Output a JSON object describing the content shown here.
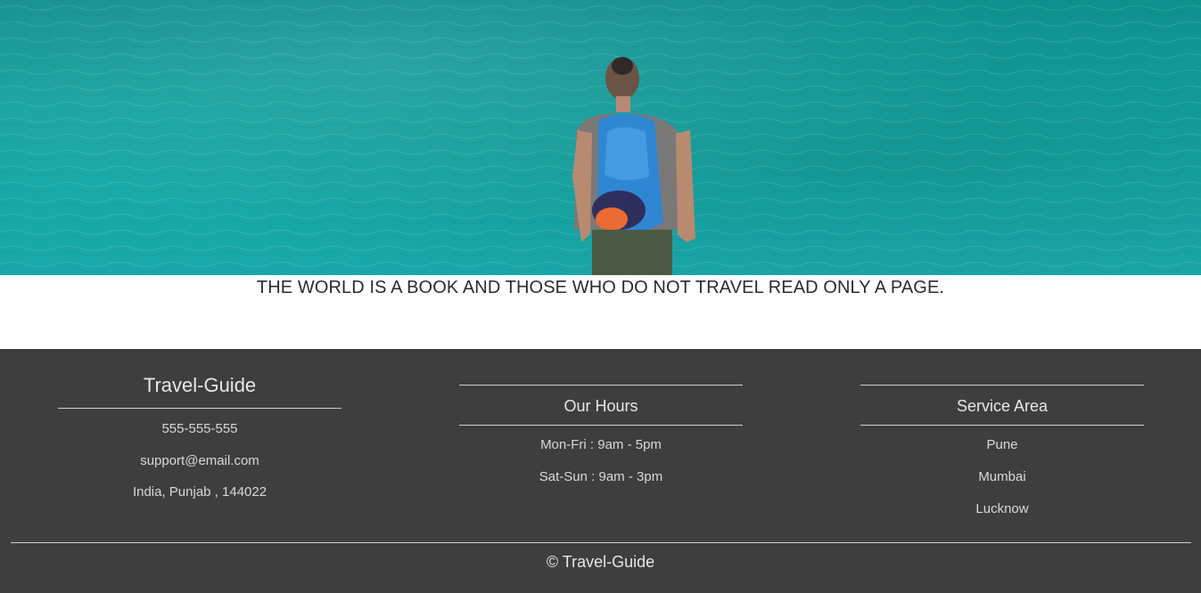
{
  "hero": {
    "quote": "THE WORLD IS A BOOK AND THOSE WHO DO NOT TRAVEL READ ONLY A PAGE."
  },
  "footer": {
    "brand": {
      "title": "Travel-Guide",
      "phone": "555-555-555",
      "email": "support@email.com",
      "address": "India, Punjab , 144022"
    },
    "hours": {
      "title": "Our Hours",
      "items": [
        "Mon-Fri : 9am - 5pm",
        "Sat-Sun : 9am - 3pm"
      ]
    },
    "service_area": {
      "title": "Service Area",
      "items": [
        "Pune",
        "Mumbai",
        "Lucknow"
      ]
    },
    "copyright": "© Travel-Guide"
  },
  "colors": {
    "footer_bg": "#3e3e3e",
    "water": "#17a9a7",
    "text_light": "#e2e2e2"
  }
}
